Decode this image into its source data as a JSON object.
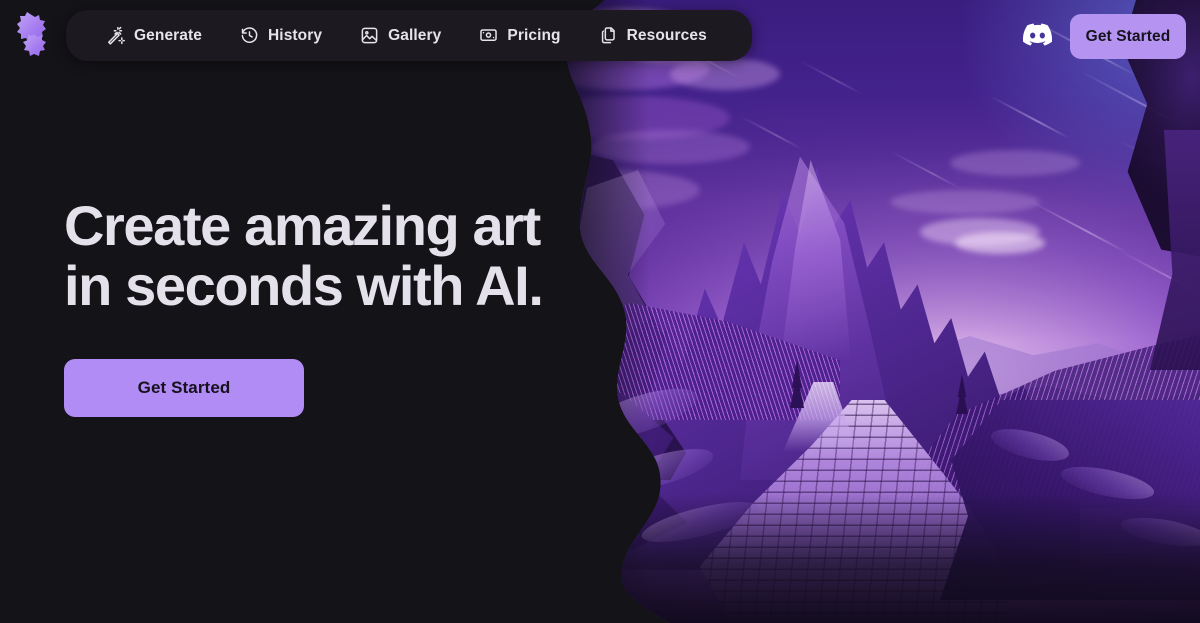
{
  "brand": {
    "logo_icon": "puzzle-blob-logo-icon",
    "logo_color": "#ab84f0"
  },
  "nav": {
    "items": [
      {
        "label": "Generate",
        "icon": "magic-wand-icon"
      },
      {
        "label": "History",
        "icon": "clock-history-icon"
      },
      {
        "label": "Gallery",
        "icon": "image-photo-icon"
      },
      {
        "label": "Pricing",
        "icon": "banknote-money-icon"
      },
      {
        "label": "Resources",
        "icon": "documents-stack-icon"
      }
    ],
    "discord_icon": "discord-logo-icon",
    "cta_label": "Get Started",
    "cta_color": "#b494f0"
  },
  "hero": {
    "headline_line_1": "Create amazing art",
    "headline_line_2": "in seconds with AI.",
    "headline_color": "#e4e1ea",
    "cta_label": "Get Started",
    "cta_color": "#b18cf5",
    "cta_text_color": "#16111d"
  },
  "artwork": {
    "alt": "Purple fantasy landscape: jagged mountain peak, cobblestone path, starry gradient sky",
    "accent": "#8b4fd0",
    "sky_top": "#3a1d7e",
    "sky_horizon": "#e9c9ef"
  },
  "page": {
    "background": "#141318"
  }
}
